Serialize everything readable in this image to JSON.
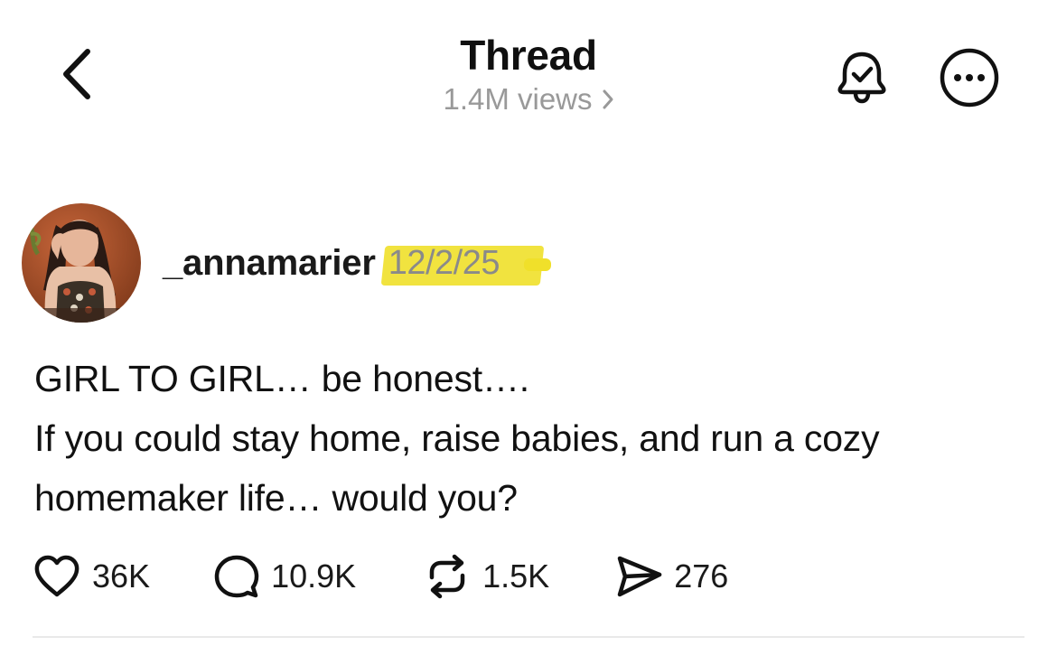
{
  "header": {
    "title": "Thread",
    "views": "1.4M views"
  },
  "post": {
    "username": "_annamarier",
    "date": "12/2/25",
    "highlight_color": "#f0e02a",
    "lines": [
      "GIRL TO GIRL… be honest….",
      "If you could stay home, raise babies, and run a cozy homemaker life… would you?"
    ]
  },
  "actions": {
    "likes": "36K",
    "replies": "10.9K",
    "reposts": "1.5K",
    "shares": "276"
  },
  "icons": {
    "back": "chevron-left-icon",
    "views_chevron": "chevron-right-icon",
    "bell": "bell-check-icon",
    "more": "more-circle-icon",
    "like": "heart-icon",
    "reply": "comment-icon",
    "repost": "repost-icon",
    "share": "send-icon"
  }
}
